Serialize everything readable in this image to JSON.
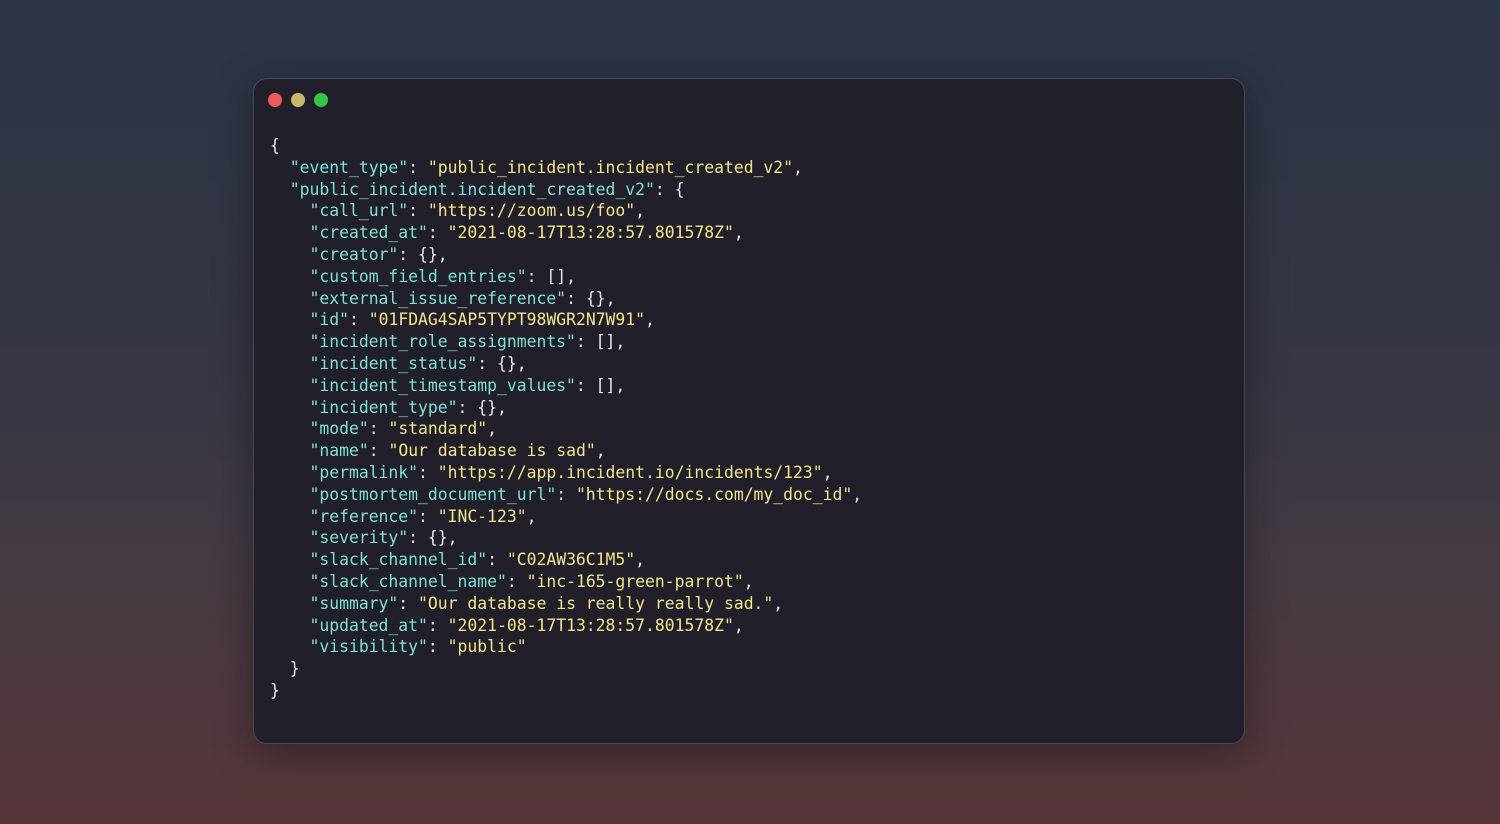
{
  "window": {
    "traffic_lights": [
      {
        "name": "close",
        "color": "#f05a5a"
      },
      {
        "name": "minimize",
        "color": "#c9b66b"
      },
      {
        "name": "maximize",
        "color": "#33c748"
      }
    ],
    "colors": {
      "key": "#7fe1d6",
      "string": "#f2e58c",
      "punctuation": "#e8e8ec"
    }
  },
  "code_lines": [
    {
      "indent": 0,
      "key": "",
      "sep": "",
      "value": "",
      "vtype": "p",
      "tail": "{"
    },
    {
      "indent": 1,
      "key": "\"event_type\"",
      "sep": ": ",
      "value": "\"public_incident.incident_created_v2\"",
      "vtype": "s",
      "tail": ","
    },
    {
      "indent": 1,
      "key": "\"public_incident.incident_created_v2\"",
      "sep": ": ",
      "value": "{",
      "vtype": "p",
      "tail": ""
    },
    {
      "indent": 2,
      "key": "\"call_url\"",
      "sep": ": ",
      "value": "\"https://zoom.us/foo\"",
      "vtype": "s",
      "tail": ","
    },
    {
      "indent": 2,
      "key": "\"created_at\"",
      "sep": ": ",
      "value": "\"2021-08-17T13:28:57.801578Z\"",
      "vtype": "s",
      "tail": ","
    },
    {
      "indent": 2,
      "key": "\"creator\"",
      "sep": ": ",
      "value": "{}",
      "vtype": "p",
      "tail": ","
    },
    {
      "indent": 2,
      "key": "\"custom_field_entries\"",
      "sep": ": ",
      "value": "[]",
      "vtype": "p",
      "tail": ","
    },
    {
      "indent": 2,
      "key": "\"external_issue_reference\"",
      "sep": ": ",
      "value": "{}",
      "vtype": "p",
      "tail": ","
    },
    {
      "indent": 2,
      "key": "\"id\"",
      "sep": ": ",
      "value": "\"01FDAG4SAP5TYPT98WGR2N7W91\"",
      "vtype": "s",
      "tail": ","
    },
    {
      "indent": 2,
      "key": "\"incident_role_assignments\"",
      "sep": ": ",
      "value": "[]",
      "vtype": "p",
      "tail": ","
    },
    {
      "indent": 2,
      "key": "\"incident_status\"",
      "sep": ": ",
      "value": "{}",
      "vtype": "p",
      "tail": ","
    },
    {
      "indent": 2,
      "key": "\"incident_timestamp_values\"",
      "sep": ": ",
      "value": "[]",
      "vtype": "p",
      "tail": ","
    },
    {
      "indent": 2,
      "key": "\"incident_type\"",
      "sep": ": ",
      "value": "{}",
      "vtype": "p",
      "tail": ","
    },
    {
      "indent": 2,
      "key": "\"mode\"",
      "sep": ": ",
      "value": "\"standard\"",
      "vtype": "s",
      "tail": ","
    },
    {
      "indent": 2,
      "key": "\"name\"",
      "sep": ": ",
      "value": "\"Our database is sad\"",
      "vtype": "s",
      "tail": ","
    },
    {
      "indent": 2,
      "key": "\"permalink\"",
      "sep": ": ",
      "value": "\"https://app.incident.io/incidents/123\"",
      "vtype": "s",
      "tail": ","
    },
    {
      "indent": 2,
      "key": "\"postmortem_document_url\"",
      "sep": ": ",
      "value": "\"https://docs.com/my_doc_id\"",
      "vtype": "s",
      "tail": ","
    },
    {
      "indent": 2,
      "key": "\"reference\"",
      "sep": ": ",
      "value": "\"INC-123\"",
      "vtype": "s",
      "tail": ","
    },
    {
      "indent": 2,
      "key": "\"severity\"",
      "sep": ": ",
      "value": "{}",
      "vtype": "p",
      "tail": ","
    },
    {
      "indent": 2,
      "key": "\"slack_channel_id\"",
      "sep": ": ",
      "value": "\"C02AW36C1M5\"",
      "vtype": "s",
      "tail": ","
    },
    {
      "indent": 2,
      "key": "\"slack_channel_name\"",
      "sep": ": ",
      "value": "\"inc-165-green-parrot\"",
      "vtype": "s",
      "tail": ","
    },
    {
      "indent": 2,
      "key": "\"summary\"",
      "sep": ": ",
      "value": "\"Our database is really really sad.\"",
      "vtype": "s",
      "tail": ","
    },
    {
      "indent": 2,
      "key": "\"updated_at\"",
      "sep": ": ",
      "value": "\"2021-08-17T13:28:57.801578Z\"",
      "vtype": "s",
      "tail": ","
    },
    {
      "indent": 2,
      "key": "\"visibility\"",
      "sep": ": ",
      "value": "\"public\"",
      "vtype": "s",
      "tail": ""
    },
    {
      "indent": 1,
      "key": "",
      "sep": "",
      "value": "",
      "vtype": "p",
      "tail": "}"
    },
    {
      "indent": 0,
      "key": "",
      "sep": "",
      "value": "",
      "vtype": "p",
      "tail": "}"
    }
  ]
}
